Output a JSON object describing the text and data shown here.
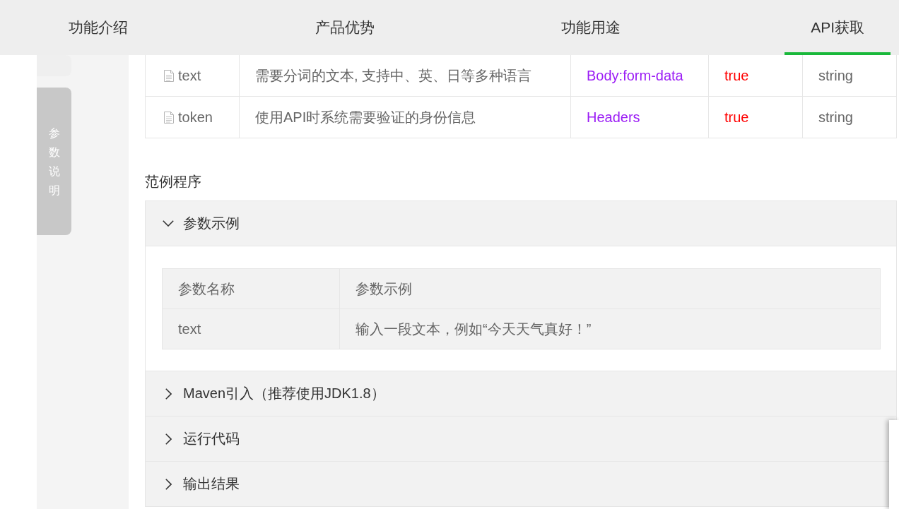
{
  "nav": {
    "tabs": [
      {
        "label": "功能介绍",
        "selected": false
      },
      {
        "label": "产品优势",
        "selected": false
      },
      {
        "label": "功能用途",
        "selected": false
      },
      {
        "label": "API获取",
        "selected": true
      }
    ]
  },
  "sidebar": {
    "items": [
      {
        "selected": false
      },
      {
        "label": "参数说明",
        "selected": true
      }
    ]
  },
  "params_table": {
    "rows": [
      [
        "text",
        "需要分词的文本, 支持中、英、日等多种语言",
        "Body:form-data",
        "true",
        "string"
      ],
      [
        "token",
        "使用API时系统需要验证的身份信息",
        "Headers",
        "true",
        "string"
      ]
    ]
  },
  "examples": {
    "title": "范例程序",
    "panels": [
      {
        "title": "参数示例",
        "expanded": true,
        "table": {
          "columns": [
            "参数名称",
            "参数示例"
          ],
          "rows": [
            [
              "text",
              "输入一段文本，例如“今天天气真好！”"
            ]
          ]
        }
      },
      {
        "title": "Maven引入（推荐使用JDK1.8）",
        "expanded": false
      },
      {
        "title": "运行代码",
        "expanded": false
      },
      {
        "title": "输出结果",
        "expanded": false
      }
    ]
  }
}
